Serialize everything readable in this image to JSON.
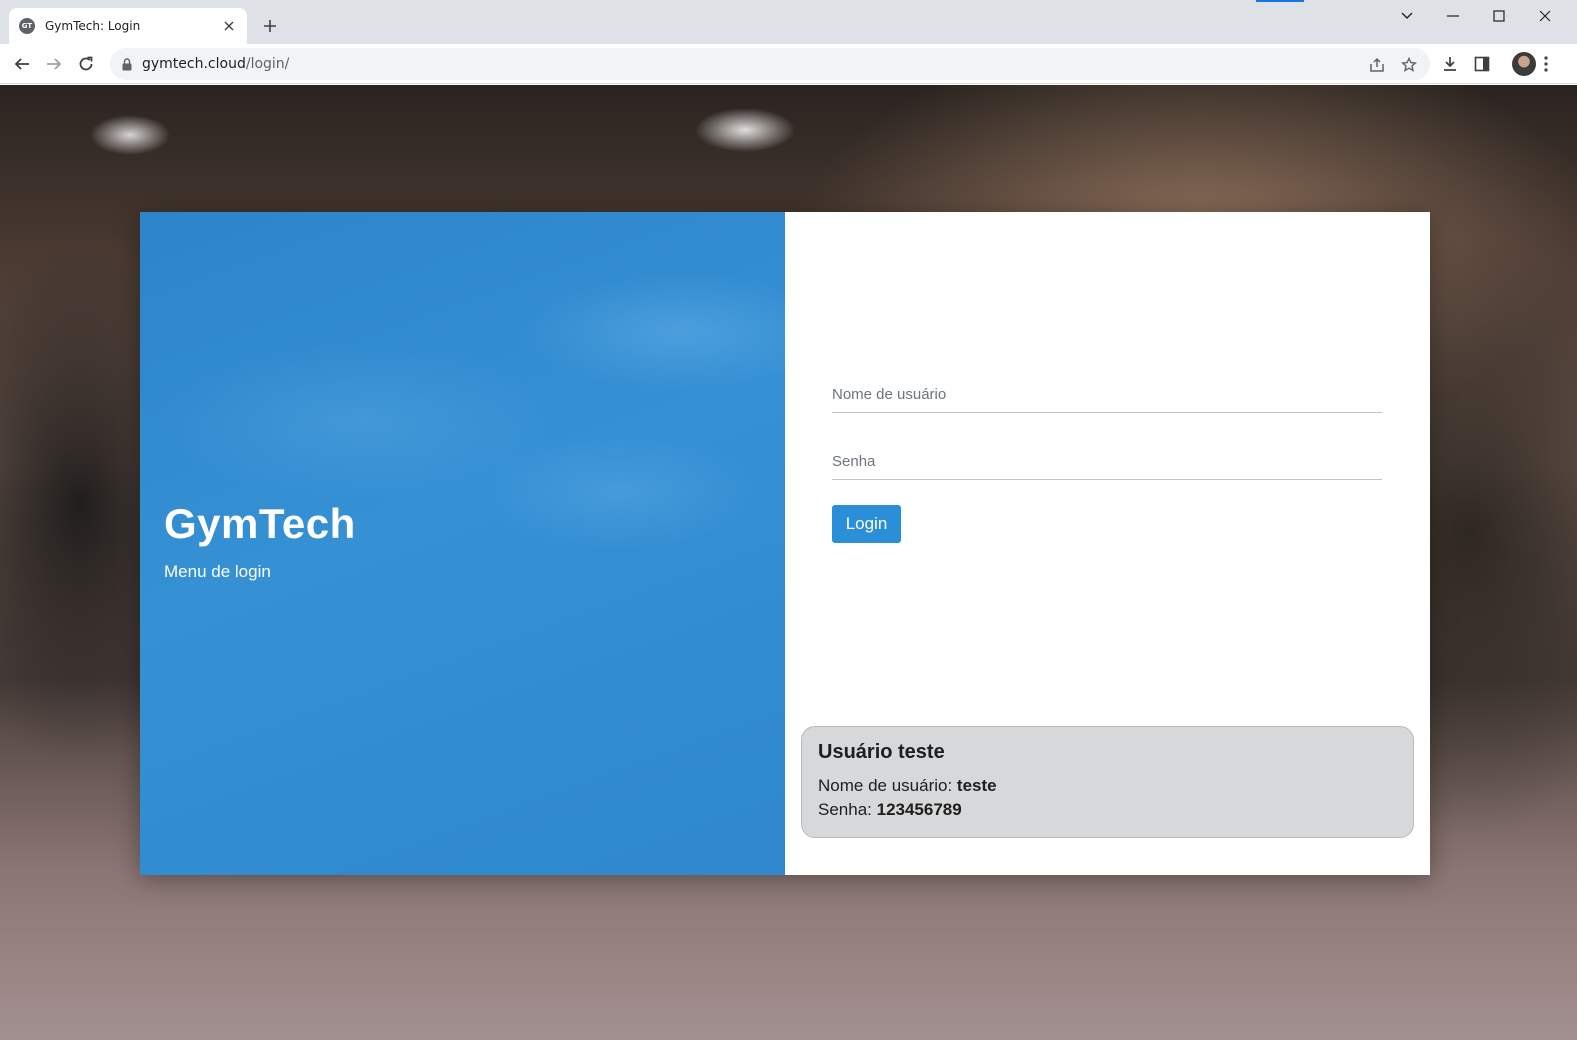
{
  "browser": {
    "tab_title": "GymTech: Login",
    "favicon_text": "GT",
    "url_host": "gymtech.cloud",
    "url_path": "/login/"
  },
  "brand": {
    "title": "GymTech",
    "subtitle": "Menu de login"
  },
  "form": {
    "username_placeholder": "Nome de usuário",
    "password_placeholder": "Senha",
    "login_label": "Login"
  },
  "test_user": {
    "heading": "Usuário teste",
    "username_label": "Nome de usuário: ",
    "username_value": "teste",
    "password_label": "Senha: ",
    "password_value": "123456789"
  },
  "colors": {
    "panel_blue": "#2d85c9",
    "button_blue": "#2b8ed8",
    "test_box_bg": "#d7d8da"
  }
}
